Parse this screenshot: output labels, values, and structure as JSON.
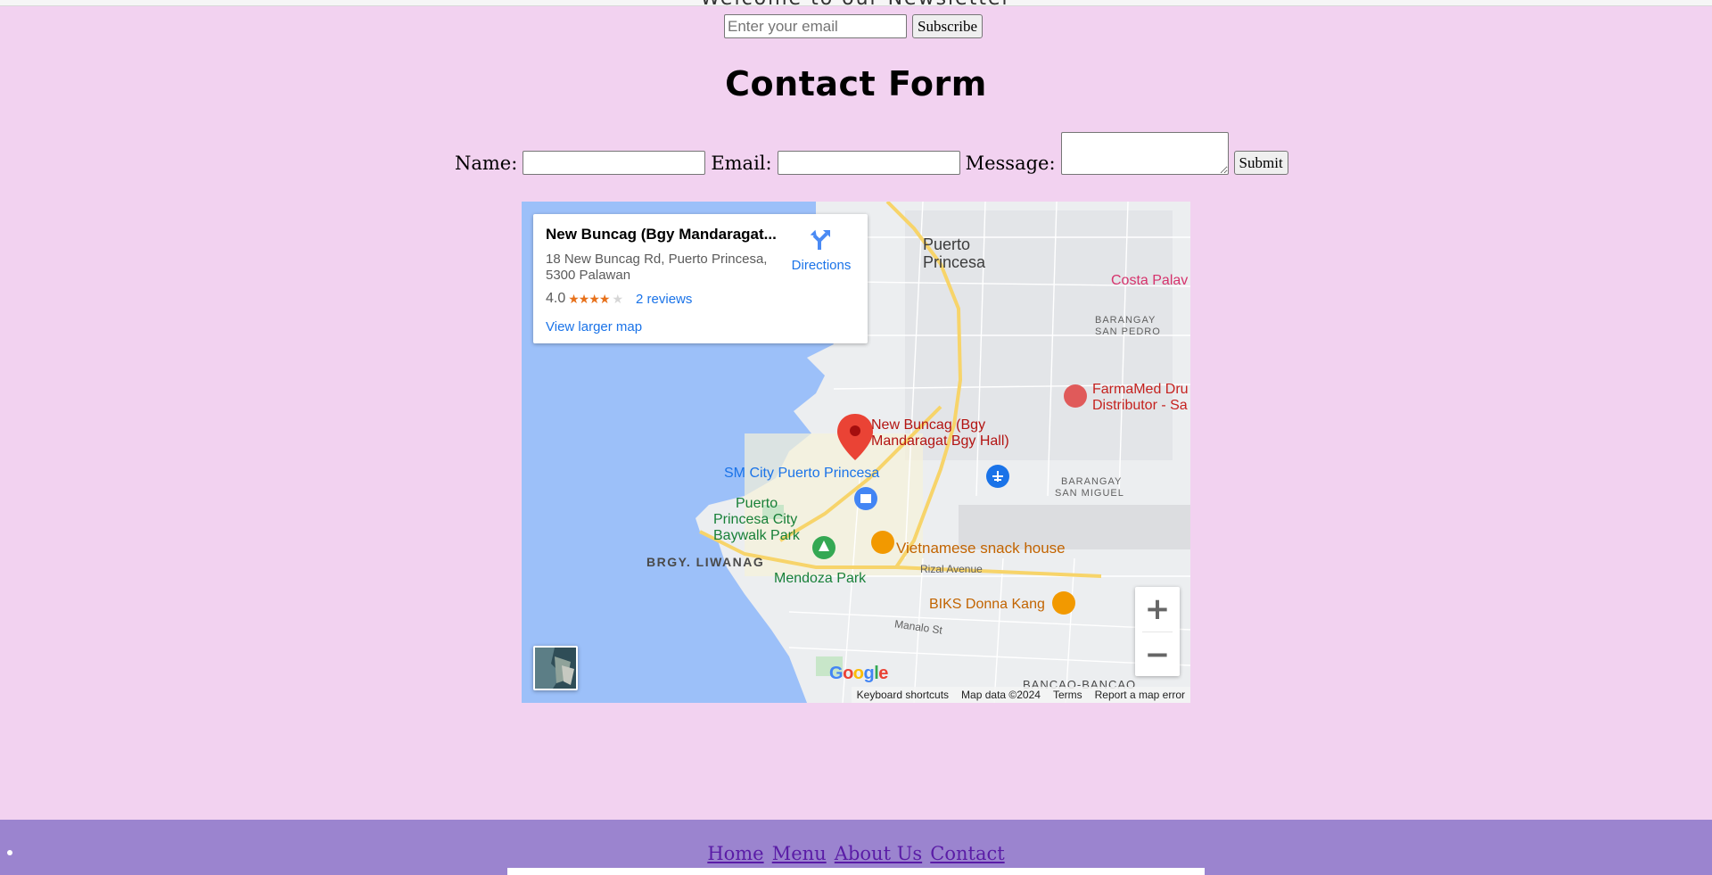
{
  "newsletter": {
    "heading": "Welcome to our Newsletter",
    "email_placeholder": "Enter your email",
    "subscribe_label": "Subscribe"
  },
  "contact": {
    "title": "Contact Form",
    "name_label": "Name:",
    "email_label": "Email:",
    "message_label": "Message:",
    "submit_label": "Submit"
  },
  "map": {
    "card": {
      "title": "New Buncag (Bgy Mandaragat...",
      "address_line1": "18 New Buncag Rd, Puerto Princesa,",
      "address_line2": "5300 Palawan",
      "rating": "4.0",
      "stars": "★★★★",
      "star_empty": "★",
      "reviews": "2 reviews",
      "larger_map": "View larger map",
      "directions": "Directions"
    },
    "labels": {
      "puerto_princesa_1": "Puerto",
      "puerto_princesa_2": "Princesa",
      "costa_palawan": "Costa Palav",
      "barangay_san_pedro_1": "BARANGAY",
      "barangay_san_pedro_2": "SAN PEDRO",
      "farmamed_1": "FarmaMed Dru",
      "farmamed_2": "Distributor - Sa",
      "pin_1": "New Buncag (Bgy",
      "pin_2": "Mandaragat Bgy Hall)",
      "sm_city": "SM City Puerto Princesa",
      "barangay_san_miguel_1": "BARANGAY",
      "barangay_san_miguel_2": "SAN MIGUEL",
      "baywalk_1": "Puerto",
      "baywalk_2": "Princesa City",
      "baywalk_3": "Baywalk Park",
      "vietnamese": "Vietnamese snack house",
      "brgy_liwanag": "BRGY. LIWANAG",
      "rizal_avenue": "Rizal Avenue",
      "mendoza_park": "Mendoza Park",
      "biks": "BIKS Donna Kang",
      "manalo_st": "Manalo St",
      "bancao": "BANCAO-BANCAO",
      "google": "Google"
    },
    "zoom_in": "+",
    "zoom_out": "−",
    "attribution": {
      "shortcuts": "Keyboard shortcuts",
      "map_data": "Map data ©2024",
      "terms": "Terms",
      "report": "Report a map error"
    }
  },
  "footer": {
    "links": [
      "Home",
      "Menu",
      "About Us",
      "Contact"
    ]
  },
  "colors": {
    "page_bg": "#f2d2f0",
    "footer_bg": "#9b84cf",
    "link": "#5a1ca6",
    "water": "#9cc0f9",
    "pin_red": "#ea4335",
    "maps_blue": "#1a73e8"
  }
}
